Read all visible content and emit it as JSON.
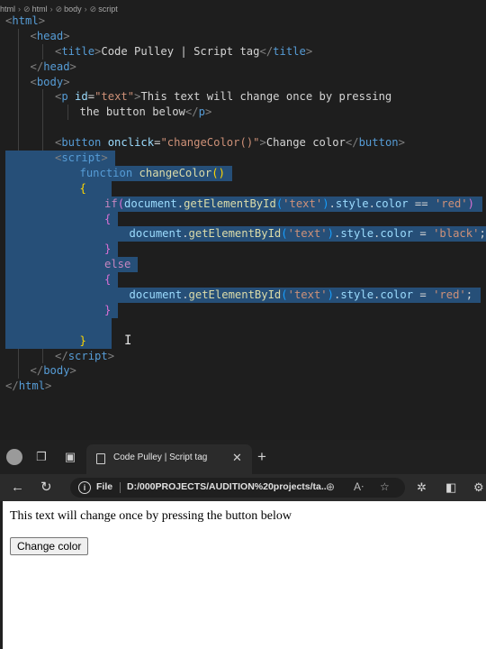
{
  "editor": {
    "breadcrumb": [
      "html",
      "html",
      "body",
      "script"
    ],
    "lines": [
      {
        "indent": 0,
        "tokens": [
          [
            "pun",
            "<"
          ],
          [
            "tag",
            "html"
          ],
          [
            "pun",
            ">"
          ]
        ]
      },
      {
        "indent": 1,
        "tokens": [
          [
            "pun",
            "<"
          ],
          [
            "tag",
            "head"
          ],
          [
            "pun",
            ">"
          ]
        ]
      },
      {
        "indent": 2,
        "tokens": [
          [
            "pun",
            "<"
          ],
          [
            "tag",
            "title"
          ],
          [
            "pun",
            ">"
          ],
          [
            "plain",
            "Code Pulley | Script tag"
          ],
          [
            "pun",
            "</"
          ],
          [
            "tag",
            "title"
          ],
          [
            "pun",
            ">"
          ]
        ]
      },
      {
        "indent": 1,
        "tokens": [
          [
            "pun",
            "</"
          ],
          [
            "tag",
            "head"
          ],
          [
            "pun",
            ">"
          ]
        ]
      },
      {
        "indent": 1,
        "tokens": [
          [
            "pun",
            "<"
          ],
          [
            "tag",
            "body"
          ],
          [
            "pun",
            ">"
          ]
        ]
      },
      {
        "indent": 2,
        "tokens": [
          [
            "pun",
            "<"
          ],
          [
            "tag",
            "p"
          ],
          [
            "plain",
            " "
          ],
          [
            "att",
            "id"
          ],
          [
            "plain",
            "="
          ],
          [
            "str",
            "\"text\""
          ],
          [
            "pun",
            ">"
          ],
          [
            "plain",
            "This text will change once by pressing"
          ]
        ]
      },
      {
        "indent": 3,
        "tokens": [
          [
            "plain",
            "the button below"
          ],
          [
            "pun",
            "</"
          ],
          [
            "tag",
            "p"
          ],
          [
            "pun",
            ">"
          ]
        ]
      },
      {
        "indent": 2,
        "tokens": []
      },
      {
        "indent": 2,
        "tokens": [
          [
            "pun",
            "<"
          ],
          [
            "tag",
            "button"
          ],
          [
            "plain",
            " "
          ],
          [
            "att",
            "onclick"
          ],
          [
            "plain",
            "="
          ],
          [
            "str",
            "\"changeColor()\""
          ],
          [
            "pun",
            ">"
          ],
          [
            "plain",
            "Change color"
          ],
          [
            "pun",
            "</"
          ],
          [
            "tag",
            "button"
          ],
          [
            "pun",
            ">"
          ]
        ]
      },
      {
        "indent": 2,
        "tokens": [
          [
            "pun",
            "<"
          ],
          [
            "tag",
            "script"
          ],
          [
            "pun",
            ">"
          ]
        ]
      },
      {
        "indent": 3,
        "tokens": [
          [
            "kw",
            "function"
          ],
          [
            "plain",
            " "
          ],
          [
            "fn",
            "changeColor"
          ],
          [
            "br1",
            "()"
          ]
        ]
      },
      {
        "indent": 3,
        "tokens": [
          [
            "br1",
            "{"
          ]
        ]
      },
      {
        "indent": 4,
        "tokens": [
          [
            "kc",
            "if"
          ],
          [
            "br2",
            "("
          ],
          [
            "att",
            "document"
          ],
          [
            "plain",
            "."
          ],
          [
            "fn",
            "getElementById"
          ],
          [
            "br3",
            "("
          ],
          [
            "str",
            "'text'"
          ],
          [
            "br3",
            ")"
          ],
          [
            "plain",
            "."
          ],
          [
            "att",
            "style"
          ],
          [
            "plain",
            "."
          ],
          [
            "att",
            "color"
          ],
          [
            "plain",
            " == "
          ],
          [
            "str",
            "'red'"
          ],
          [
            "br2",
            ")"
          ]
        ]
      },
      {
        "indent": 4,
        "tokens": [
          [
            "br2",
            "{"
          ]
        ]
      },
      {
        "indent": 5,
        "tokens": [
          [
            "att",
            "document"
          ],
          [
            "plain",
            "."
          ],
          [
            "fn",
            "getElementById"
          ],
          [
            "br3",
            "("
          ],
          [
            "str",
            "'text'"
          ],
          [
            "br3",
            ")"
          ],
          [
            "plain",
            "."
          ],
          [
            "att",
            "style"
          ],
          [
            "plain",
            "."
          ],
          [
            "att",
            "color"
          ],
          [
            "plain",
            " = "
          ],
          [
            "str",
            "'black'"
          ],
          [
            "plain",
            ";"
          ]
        ]
      },
      {
        "indent": 4,
        "tokens": [
          [
            "br2",
            "}"
          ]
        ]
      },
      {
        "indent": 4,
        "tokens": [
          [
            "kc",
            "else"
          ]
        ]
      },
      {
        "indent": 4,
        "tokens": [
          [
            "br2",
            "{"
          ]
        ]
      },
      {
        "indent": 5,
        "tokens": [
          [
            "att",
            "document"
          ],
          [
            "plain",
            "."
          ],
          [
            "fn",
            "getElementById"
          ],
          [
            "br3",
            "("
          ],
          [
            "str",
            "'text'"
          ],
          [
            "br3",
            ")"
          ],
          [
            "plain",
            "."
          ],
          [
            "att",
            "style"
          ],
          [
            "plain",
            "."
          ],
          [
            "att",
            "color"
          ],
          [
            "plain",
            " = "
          ],
          [
            "str",
            "'red'"
          ],
          [
            "plain",
            ";"
          ]
        ]
      },
      {
        "indent": 4,
        "tokens": [
          [
            "br2",
            "}"
          ]
        ]
      },
      {
        "indent": 4,
        "tokens": []
      },
      {
        "indent": 3,
        "tokens": [
          [
            "br1",
            "}"
          ]
        ]
      },
      {
        "indent": 2,
        "tokens": [
          [
            "pun",
            "</"
          ],
          [
            "tag",
            "script"
          ],
          [
            "pun",
            ">"
          ]
        ]
      },
      {
        "indent": 1,
        "tokens": [
          [
            "pun",
            "</"
          ],
          [
            "tag",
            "body"
          ],
          [
            "pun",
            ">"
          ]
        ]
      },
      {
        "indent": 0,
        "tokens": [
          [
            "pun",
            "</"
          ],
          [
            "tag",
            "html"
          ],
          [
            "pun",
            ">"
          ]
        ]
      }
    ],
    "selection_lines": [
      9,
      10,
      11,
      12,
      13,
      14,
      15,
      16,
      17,
      18,
      19,
      20,
      21
    ]
  },
  "browser": {
    "tab_title": "Code Pulley | Script tag",
    "address_label": "File",
    "url": "D:/000PROJECTS/AUDITION%20projects/ta...",
    "icons": {
      "profile": "avatar-icon",
      "workspaces": "workspaces-icon",
      "tab_actions": "tab-actions-icon",
      "close_tab": "close-icon",
      "new_tab": "plus-icon",
      "back": "back-arrow-icon",
      "reload": "reload-icon",
      "info": "info-icon",
      "zoom": "zoom-icon",
      "read_aloud": "read-aloud-icon",
      "favorite": "star-icon",
      "extensions": "extensions-icon",
      "collections": "collections-icon",
      "settings": "gear-icon"
    }
  },
  "page": {
    "paragraph": "This text will change once by pressing the button below",
    "button_label": "Change color"
  }
}
